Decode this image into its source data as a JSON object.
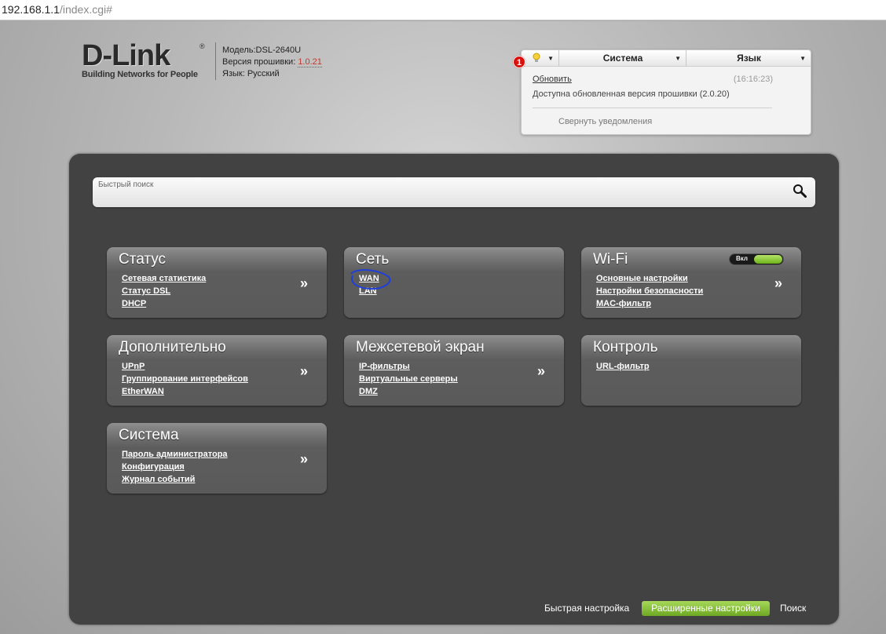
{
  "address_bar": {
    "host": "192.168.1.1",
    "path": "/index.cgi#"
  },
  "header": {
    "logo_text": "D-Link",
    "logo_reg": "®",
    "logo_tagline": "Building Networks for People",
    "model_label": "Модель:",
    "model_value": "DSL-2640U",
    "firmware_label": "Версия прошивки: ",
    "firmware_value": "1.0.21",
    "language_label": "Язык: ",
    "language_value": "Русский"
  },
  "notifications": {
    "count": "1",
    "menu_system": "Система",
    "menu_language": "Язык",
    "update_link": "Обновить",
    "time": "(16:16:23)",
    "message": "Доступна обновленная версия прошивки (2.0.20)",
    "collapse": "Свернуть уведомления"
  },
  "search": {
    "placeholder": "Быстрый поиск"
  },
  "tiles": [
    {
      "title": "Статус",
      "links": [
        "Сетевая статистика",
        "Статус DSL",
        "DHCP"
      ],
      "more": "»"
    },
    {
      "title": "Сеть",
      "links": [
        "WAN",
        "LAN"
      ]
    },
    {
      "title": "Wi-Fi",
      "links": [
        "Основные настройки",
        "Настройки безопасности",
        "MAC-фильтр"
      ],
      "more": "»",
      "toggle": "Вкл"
    },
    {
      "title": "Дополнительно",
      "links": [
        "UPnP",
        "Группирование интерфейсов",
        "EtherWAN"
      ],
      "more": "»"
    },
    {
      "title": "Межсетевой экран",
      "links": [
        "IP-фильтры",
        "Виртуальные серверы",
        "DMZ"
      ],
      "more": "»"
    },
    {
      "title": "Контроль",
      "links": [
        "URL-фильтр"
      ]
    },
    {
      "title": "Система",
      "links": [
        "Пароль администратора",
        "Конфигурация",
        "Журнал событий"
      ],
      "more": "»"
    }
  ],
  "footer": {
    "quick_setup": "Быстрая настройка",
    "advanced_settings": "Расширенные настройки",
    "search": "Поиск"
  },
  "colors": {
    "accent_green": "#8cc63f",
    "badge_red": "#d9100c",
    "panel_dark": "#424242",
    "annotation_blue": "#1f3fd6"
  }
}
